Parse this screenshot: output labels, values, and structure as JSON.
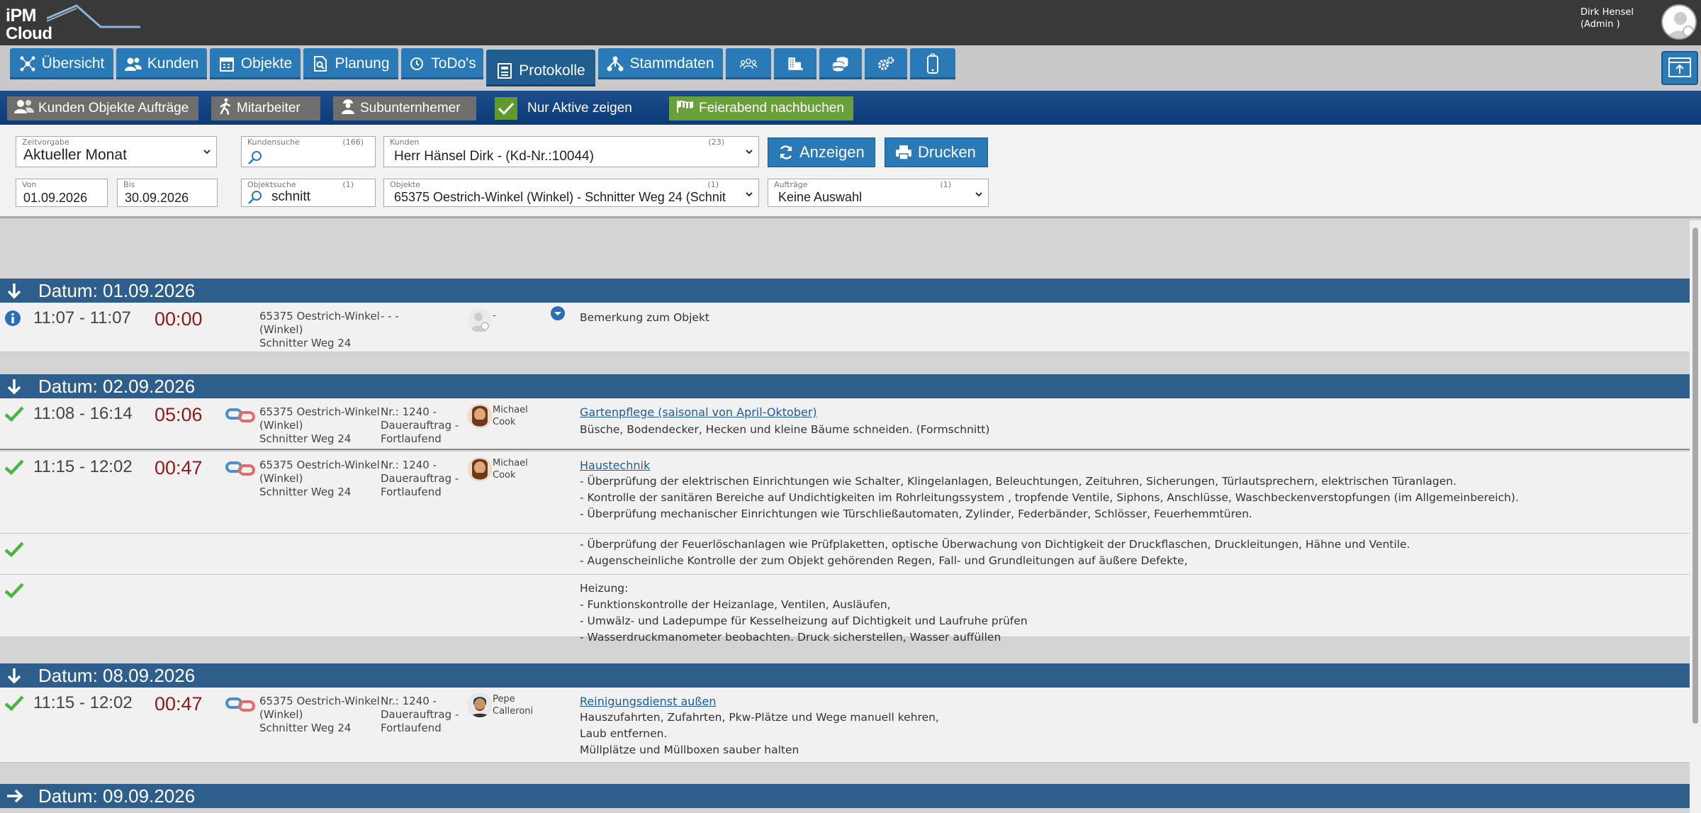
{
  "app": {
    "logo_line1": "iPM",
    "logo_line2": "Cloud"
  },
  "user": {
    "name": "Dirk Hensel",
    "role": "(Admin )"
  },
  "nav": {
    "ubersicht": "Übersicht",
    "kunden": "Kunden",
    "objekte": "Objekte",
    "planung": "Planung",
    "todos": "ToDo's",
    "protokolle": "Protokolle",
    "stammdaten": "Stammdaten"
  },
  "subbar": {
    "kunden_objekte": "Kunden Objekte Aufträge",
    "mitarbeiter": "Mitarbeiter",
    "subunternehmer": "Subunternhemer",
    "nur_aktive": "Nur Aktive zeigen",
    "feierabend": "Feierabend nachbuchen"
  },
  "filters": {
    "zeitvorgabe": {
      "label": "Zeitvorgabe",
      "value": "Aktueller Monat"
    },
    "kundensuche": {
      "label": "Kundensuche",
      "count": "(166)",
      "value": ""
    },
    "kunden": {
      "label": "Kunden",
      "count": "(23)",
      "value": "Herr Hänsel Dirk - (Kd-Nr.:10044)"
    },
    "von": {
      "label": "Von",
      "value": "01.09.2026"
    },
    "bis": {
      "label": "Bis",
      "value": "30.09.2026"
    },
    "objektsuche": {
      "label": "Objektsuche",
      "count": "(1)",
      "value": "schnitt"
    },
    "objekte": {
      "label": "Objekte",
      "count": "(1)",
      "value": "65375 Oestrich-Winkel (Winkel) - Schnitter Weg 24 (Schnit"
    },
    "auftrage": {
      "label": "Aufträge",
      "count": "(1)",
      "value": "Keine Auswahl"
    },
    "anzeigen": "Anzeigen",
    "drucken": "Drucken"
  },
  "days": [
    {
      "label": "Datum: 01.09.2026"
    },
    {
      "label": "Datum: 02.09.2026"
    },
    {
      "label": "Datum: 08.09.2026"
    },
    {
      "label": "Datum: 09.09.2026"
    }
  ],
  "entries": {
    "e1": {
      "time": "11:07 - 11:07",
      "duration": "00:00",
      "address": "65375 Oestrich-Winkel\n(Winkel)\nSchnitter Weg 24",
      "auftrag": "- - -",
      "mitarbeiter": "-",
      "text": "Bemerkung zum Objekt"
    },
    "e2": {
      "time": "11:08 - 16:14",
      "duration": "05:06",
      "address": "65375 Oestrich-Winkel\n(Winkel)\nSchnitter Weg 24",
      "auftrag": "Nr.: 1240 -\nDauerauftrag -\nFortlaufend",
      "mitarbeiter": "Michael\nCook",
      "title": "Gartenpflege (saisonal von April-Oktober)",
      "text": "Büsche, Bodendecker, Hecken und kleine Bäume schneiden. (Formschnitt)"
    },
    "e3": {
      "time": "11:15 - 12:02",
      "duration": "00:47",
      "address": "65375 Oestrich-Winkel\n(Winkel)\nSchnitter Weg 24",
      "auftrag": "Nr.: 1240 -\nDauerauftrag -\nFortlaufend",
      "mitarbeiter": "Michael\nCook",
      "title": "Haustechnik",
      "text": "- Überprüfung der elektrischen Einrichtungen wie Schalter, Klingelanlagen, Beleuchtungen, Zeituhren, Sicherungen, Türlautsprechern, elektrischen Türanlagen.\n- Kontrolle der sanitären Bereiche auf Undichtigkeiten im Rohrleitungssystem , tropfende Ventile, Siphons, Anschlüsse, Waschbeckenverstopfungen (im Allgemeinbereich).\n- Überprüfung mechanischer Einrichtungen wie Türschließautomaten, Zylinder, Federbänder, Schlösser, Feuerhemmtüren."
    },
    "e3b": {
      "text": "- Überprüfung der Feuerlöschanlagen wie Prüfplaketten, optische Überwachung von Dichtigkeit der Druckflaschen, Druckleitungen, Hähne und Ventile.\n- Augenscheinliche Kontrolle der zum Objekt gehörenden Regen, Fall- und Grundleitungen auf äußere Defekte,"
    },
    "e3c": {
      "text": "Heizung:\n- Funktionskontrolle der Heizanlage, Ventilen, Ausläufen,\n- Umwälz- und Ladepumpe für Kesselheizung auf Dichtigkeit und Laufruhe prüfen\n- Wasserdruckmanometer beobachten. Druck sicherstellen, Wasser auffüllen"
    },
    "e4": {
      "time": "11:15 - 12:02",
      "duration": "00:47",
      "address": "65375 Oestrich-Winkel\n(Winkel)\nSchnitter Weg 24",
      "auftrag": "Nr.: 1240 -\nDauerauftrag -\nFortlaufend",
      "mitarbeiter": "Pepe\nCalleroni",
      "title": "Reinigungsdienst außen",
      "text": "Hauszufahrten, Zufahrten, Pkw-Plätze und Wege manuell kehren,\nLaub entfernen.\nMüllplätze und Müllboxen sauber halten"
    }
  },
  "colors": {
    "nav_blue": "#2a7ab8",
    "day_header": "#2d5e8c",
    "duration_red": "#8b1c1c",
    "check_green": "#4bb543"
  }
}
